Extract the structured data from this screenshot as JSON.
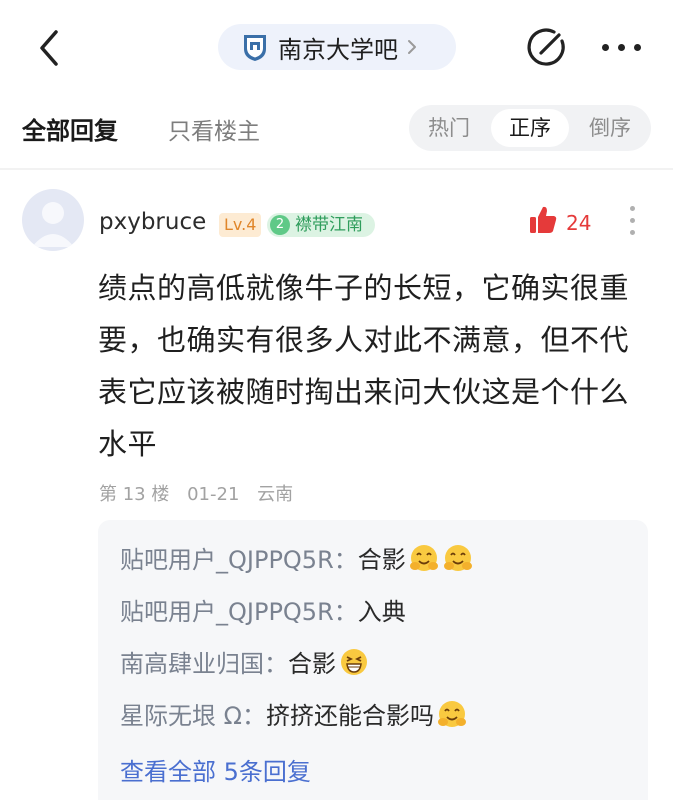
{
  "header": {
    "forum_name": "南京大学吧"
  },
  "tabs": {
    "all_replies": "全部回复",
    "op_only": "只看楼主"
  },
  "sort": {
    "hot": "热门",
    "ascending": "正序",
    "descending": "倒序",
    "selected": "正序"
  },
  "post": {
    "username": "pxybruce",
    "level": "Lv.4",
    "honor_level": "2",
    "honor_title": "襟带江南",
    "like_count": "24",
    "content": "绩点的高低就像牛子的长短，它确实很重要，也确实有很多人对此不满意，但不代表它应该被随时掏出来问大伙这是个什么水平",
    "floor": "第 13 楼",
    "date": "01-21",
    "location": "云南"
  },
  "replies": [
    {
      "author": "贴吧用户_QJPPQ5R：",
      "text": "合影",
      "emoji": [
        "hug-emoji",
        "hug-emoji"
      ]
    },
    {
      "author": "贴吧用户_QJPPQ5R：",
      "text": "入典",
      "emoji": []
    },
    {
      "author": "南高肆业归国：",
      "text": "合影",
      "emoji": [
        "grin-emoji"
      ]
    },
    {
      "author": "星际无垠 Ω：",
      "text": "挤挤还能合影吗",
      "emoji": [
        "hug-emoji"
      ]
    }
  ],
  "view_all": "查看全部 5条回复",
  "colors": {
    "accent_blue": "#4a6fd0",
    "like_red": "#e53a3a",
    "level_orange": "#e0862a",
    "honor_green": "#2f9d5c"
  }
}
